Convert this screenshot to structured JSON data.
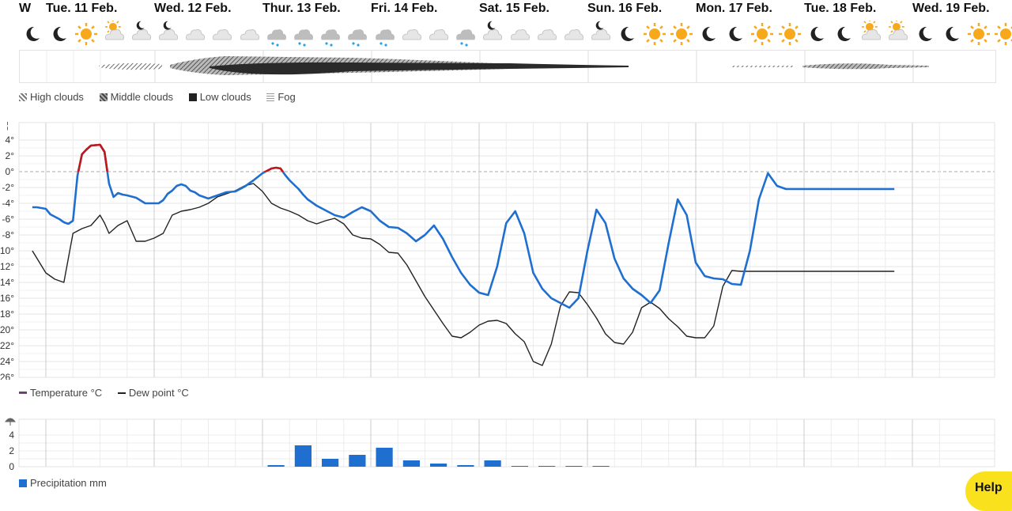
{
  "days": [
    {
      "label": "W"
    },
    {
      "label": "Tue. 11 Feb."
    },
    {
      "label": "Wed. 12 Feb."
    },
    {
      "label": "Thur. 13 Feb."
    },
    {
      "label": "Fri. 14 Feb."
    },
    {
      "label": "Sat. 15 Feb."
    },
    {
      "label": "Sun. 16 Feb."
    },
    {
      "label": "Mon. 17 Feb."
    },
    {
      "label": "Tue. 18 Feb."
    },
    {
      "label": "Wed. 19 Feb."
    }
  ],
  "weather_icons": [
    "moon",
    "moon",
    "sun",
    "cloud-sun",
    "cloud-moon",
    "cloud-moon",
    "cloud",
    "cloud",
    "cloud",
    "snow",
    "snow",
    "snow",
    "snow",
    "snow",
    "cloud",
    "cloud",
    "snow",
    "cloud-moon",
    "cloud",
    "cloud",
    "cloud",
    "cloud-moon",
    "moon",
    "sun",
    "sun",
    "moon",
    "moon",
    "sun",
    "sun",
    "moon",
    "moon",
    "cloud-sun",
    "cloud-sun",
    "moon",
    "moon",
    "sun",
    "sun"
  ],
  "cloud_legend": {
    "high": "High clouds",
    "middle": "Middle clouds",
    "low": "Low clouds",
    "fog": "Fog"
  },
  "temp_legend": {
    "temperature": "Temperature °C",
    "dew_point": "Dew point °C"
  },
  "precip_legend": {
    "precipitation": "Precipitation mm"
  },
  "colors": {
    "temperature_below_zero": "#1f6fd0",
    "temperature_above_zero": "#c0171b",
    "dew_point": "#222222",
    "precipitation": "#1f6fd0",
    "help_button": "#f9e11e"
  },
  "help_label": "Help",
  "chart_data": [
    {
      "type": "line",
      "title": "",
      "xlabel": "",
      "ylabel": "",
      "ylim": [
        -26,
        4
      ],
      "y_ticks": [
        "4°",
        "2°",
        "0°",
        "-2°",
        "-4°",
        "-6°",
        "-8°",
        "-10°",
        "-12°",
        "-14°",
        "-16°",
        "-18°",
        "-20°",
        "-22°",
        "-24°",
        "-26°"
      ],
      "x_unit": "hours from Tue. 11 Feb. 00:00",
      "series": [
        {
          "name": "Temperature °C",
          "x": [
            -3,
            -2,
            0,
            1,
            3,
            4,
            5,
            6,
            7,
            8,
            9,
            10,
            12,
            13,
            14,
            15,
            16,
            17,
            18,
            20,
            22,
            24,
            25,
            26,
            27,
            28,
            29,
            30,
            31,
            32,
            33,
            34,
            36,
            38,
            40,
            42,
            44,
            46,
            48,
            50,
            51,
            52,
            53,
            54,
            56,
            57,
            58,
            60,
            62,
            64,
            66,
            68,
            70,
            72,
            74,
            76,
            78,
            80,
            82,
            84,
            86,
            88,
            90,
            92,
            94,
            96,
            98,
            100,
            102,
            104,
            106,
            108,
            110,
            112,
            114,
            116,
            118,
            120,
            122,
            124,
            126,
            128,
            130,
            132,
            134,
            136,
            138,
            140,
            142,
            144,
            146,
            148,
            150,
            152,
            154,
            156,
            158,
            160,
            162,
            164,
            166,
            168,
            170,
            172,
            174,
            176,
            178,
            180,
            182,
            184,
            186,
            187,
            188
          ],
          "values": [
            -4.5,
            -4.5,
            -4.7,
            -5.4,
            -6.0,
            -6.4,
            -6.6,
            -6.2,
            -0.5,
            2.2,
            2.8,
            3.3,
            3.4,
            2.5,
            -1.5,
            -3.2,
            -2.7,
            -2.9,
            -3.0,
            -3.3,
            -4.0,
            -4.0,
            -4.0,
            -3.6,
            -2.8,
            -2.4,
            -1.8,
            -1.6,
            -1.8,
            -2.4,
            -2.6,
            -3.0,
            -3.4,
            -3.0,
            -2.6,
            -2.5,
            -1.9,
            -1.1,
            -0.2,
            0.4,
            0.5,
            0.4,
            -0.4,
            -1.1,
            -2.2,
            -2.9,
            -3.5,
            -4.3,
            -4.9,
            -5.5,
            -5.8,
            -5.1,
            -4.5,
            -5.0,
            -6.2,
            -7.0,
            -7.1,
            -7.8,
            -8.8,
            -8.0,
            -6.8,
            -8.5,
            -10.8,
            -12.8,
            -14.3,
            -15.3,
            -15.6,
            -12.0,
            -6.5,
            -5.0,
            -7.8,
            -12.8,
            -14.8,
            -16.0,
            -16.6,
            -17.2,
            -16.0,
            -10.0,
            -4.8,
            -6.5,
            -11.0,
            -13.5,
            -14.8,
            -15.6,
            -16.6,
            -15.0,
            -9.0,
            -3.5,
            -5.5,
            -11.5,
            -13.2,
            -13.5,
            -13.6,
            -14.2,
            -14.3,
            -10.0,
            -3.5,
            -0.2,
            -1.8,
            -2.2,
            -2.2,
            -2.2,
            -2.2,
            -2.2,
            -2.2,
            -2.2,
            -2.2,
            -2.2,
            -2.2,
            -2.2,
            -2.2,
            -2.2,
            -2.2
          ]
        },
        {
          "name": "Dew point °C",
          "x": [
            -3,
            0,
            2,
            4,
            6,
            8,
            10,
            12,
            13,
            14,
            16,
            18,
            20,
            22,
            24,
            26,
            28,
            30,
            32,
            34,
            36,
            38,
            40,
            42,
            44,
            46,
            48,
            50,
            52,
            54,
            56,
            58,
            60,
            62,
            64,
            66,
            68,
            70,
            72,
            74,
            76,
            78,
            80,
            82,
            84,
            86,
            88,
            90,
            92,
            94,
            96,
            98,
            100,
            102,
            104,
            106,
            108,
            110,
            112,
            114,
            116,
            118,
            120,
            122,
            124,
            126,
            128,
            130,
            132,
            134,
            136,
            138,
            140,
            142,
            144,
            146,
            148,
            150,
            152,
            154,
            156,
            158,
            160,
            162,
            164,
            166,
            168,
            170,
            172,
            174,
            176,
            178,
            180,
            182,
            184,
            186,
            188
          ],
          "values": [
            -10.0,
            -12.8,
            -13.6,
            -14.0,
            -7.8,
            -7.2,
            -6.8,
            -5.5,
            -6.5,
            -7.8,
            -6.8,
            -6.2,
            -8.8,
            -8.8,
            -8.4,
            -7.8,
            -5.5,
            -5.0,
            -4.8,
            -4.5,
            -4.0,
            -3.2,
            -2.8,
            -2.4,
            -1.8,
            -1.5,
            -2.5,
            -4.0,
            -4.6,
            -5.0,
            -5.5,
            -6.2,
            -6.6,
            -6.2,
            -5.9,
            -6.6,
            -8.0,
            -8.4,
            -8.5,
            -9.2,
            -10.2,
            -10.3,
            -11.8,
            -13.8,
            -15.8,
            -17.5,
            -19.2,
            -20.8,
            -21.0,
            -20.3,
            -19.4,
            -18.9,
            -18.8,
            -19.2,
            -20.5,
            -21.5,
            -24.0,
            -24.5,
            -21.8,
            -17.0,
            -15.2,
            -15.3,
            -16.8,
            -18.5,
            -20.5,
            -21.6,
            -21.8,
            -20.3,
            -17.2,
            -16.5,
            -17.3,
            -18.6,
            -19.6,
            -20.8,
            -21.0,
            -21.0,
            -19.5,
            -14.5,
            -12.5,
            -12.6,
            -12.6,
            -12.6,
            -12.6,
            -12.6,
            -12.6,
            -12.6,
            -12.6,
            -12.6,
            -12.6,
            -12.6,
            -12.6,
            -12.6,
            -12.6,
            -12.6,
            -12.6,
            -12.6,
            -12.6
          ]
        }
      ]
    },
    {
      "type": "bar",
      "title": "",
      "xlabel": "",
      "ylabel": "",
      "ylim": [
        0,
        4
      ],
      "y_ticks": [
        "4",
        "2",
        "0"
      ],
      "x_unit": "6-hour periods from Tue. 11 Feb. 00:00",
      "categories": [
        8,
        9,
        10,
        11,
        12,
        13,
        14,
        15,
        16,
        17,
        18,
        19,
        20
      ],
      "series": [
        {
          "name": "Precipitation mm",
          "values": [
            0.2,
            2.7,
            1.0,
            1.5,
            2.4,
            0.8,
            0.4,
            0.2,
            0.8,
            0.1,
            0.1,
            0.1,
            0.1
          ]
        }
      ]
    }
  ]
}
